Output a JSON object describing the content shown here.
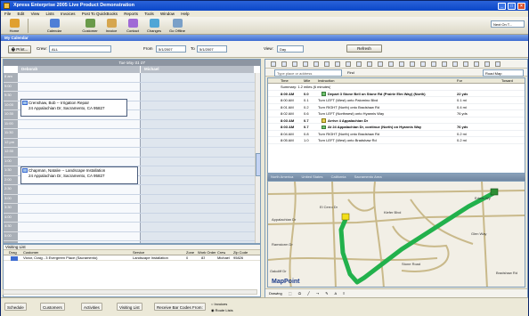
{
  "window": {
    "title": "Xpress Enterprise 2005 Live Product Demonstration",
    "controls": {
      "minimize": "_",
      "maximize": "□",
      "close": "×"
    }
  },
  "menu": [
    "File",
    "Edit",
    "View",
    "Lists",
    "Invoices",
    "Post To QuickBooks",
    "Reports",
    "Tools",
    "Window",
    "Help"
  ],
  "toolbar": {
    "buttons": [
      {
        "label": "Home",
        "color": "#e0a030"
      },
      {
        "label": "Calendar",
        "color": "#4f7fd6"
      },
      {
        "label": "Customer",
        "color": "#6a9a4a"
      },
      {
        "label": "Invoice",
        "color": "#d6a64f"
      },
      {
        "label": "Contact",
        "color": "#a06ad6"
      },
      {
        "label": "Changes",
        "color": "#4fa6d6"
      },
      {
        "label": "Go Offline",
        "color": "#7aa0c8"
      }
    ],
    "find_text": "Next On T..."
  },
  "pane_title": "My Calendar",
  "nav": {
    "print_label": "Print...",
    "crew_label": "Crew:",
    "crew_value": "ALL",
    "from_label": "From",
    "from_value": "5/1/2007",
    "to_label": "To",
    "to_value": "5/1/2007",
    "view_label": "View:",
    "view_value": "Day",
    "refresh_label": "Refresh"
  },
  "calendar": {
    "date_header": "Tue May 01 07",
    "columns": [
      "Deborah",
      "Michael"
    ],
    "times": [
      "8 am",
      "9:00",
      "9:30",
      "10:00",
      "10:30",
      "11:00",
      "11:30",
      "12 pm",
      "12:30",
      "1:00",
      "1:30",
      "2:00",
      "2:30",
      "3:00",
      "3:30",
      "4:00",
      "4:30",
      "5:00"
    ],
    "appointments": [
      {
        "line1": "Crenshaw, Bob -- Irrigation Repair",
        "line2": "24 Appalachian Dr, Sacramento, CA 95827"
      },
      {
        "line1": "Chapman, Natalie -- Landscape Installation",
        "line2": "24 Appalachian Dr, Sacramento, CA 95827"
      }
    ]
  },
  "visiting_list": {
    "title": "Visiting List",
    "headers": [
      "Drag",
      "Customer",
      "Service",
      "Zone",
      "Work Order",
      "Crew",
      "Zip Code"
    ],
    "rows": [
      [
        "",
        "Victor, Craig - 3 Evergreen Place (Sacramento)",
        "Landscape Installation",
        "0",
        "83",
        "Michael",
        "95826"
      ]
    ]
  },
  "bottom_buttons": [
    "Schedule",
    "Customers",
    "Activities",
    "Visiting List",
    "Receive Bar Codes From:"
  ],
  "bottom_radios": [
    "Invoices",
    "Route Lists"
  ],
  "directions": {
    "address_placeholder": "Type place or address",
    "find_label": "Find",
    "map_name": "Road Map",
    "headers": [
      "Time",
      "Mile",
      "Instruction",
      "For",
      "Toward"
    ],
    "summary": "Summary: 1.2 miles (6 minutes)",
    "rows": [
      {
        "time": "8:00 AM",
        "mile": "0.0",
        "text": "Depart 3 Stone Bell on Stone Rd (Prairie Elm Way) (North)",
        "for": "22 yds",
        "bold": true
      },
      {
        "time": "8:00 AM",
        "mile": "0.1",
        "text": "Turn LEFT (West) onto Palomino Blvd",
        "for": "0.1 mi",
        "bold": false
      },
      {
        "time": "8:01 AM",
        "mile": "0.2",
        "text": "Turn RIGHT (North) onto Bradshaw Rd",
        "for": "0.4 mi",
        "bold": false
      },
      {
        "time": "8:02 AM",
        "mile": "0.6",
        "text": "Turn LEFT (Northwest) onto Hyannis Way",
        "for": "76 yds",
        "bold": false
      },
      {
        "time": "8:03 AM",
        "mile": "0.7",
        "text": "Arrive 4 Appalachian Dr",
        "for": "",
        "bold": true
      },
      {
        "time": "8:03 AM",
        "mile": "0.7",
        "text": "At 24 Appalachian Dr, continue (North) on Hyannis Way",
        "for": "76 yds",
        "bold": true
      },
      {
        "time": "8:04 AM",
        "mile": "0.8",
        "text": "Turn RIGHT (North) onto Bradshaw Rd",
        "for": "0.2 mi",
        "bold": false
      },
      {
        "time": "8:05 AM",
        "mile": "1.0",
        "text": "Turn LEFT (West) onto Bradshaw Rd",
        "for": "0.2 mi",
        "bold": false
      }
    ],
    "map_header_items": [
      "North America",
      "United States",
      "California",
      "Sacramento Area"
    ],
    "street_labels": [
      "Appalachian Dr",
      "Ramstorm Dr",
      "Oakcliff Dr",
      "El Cerro Dr",
      "Kiefer Blvd",
      "Stone Road",
      "Glen Way",
      "Bradshaw Rd",
      "Edwin Wy"
    ],
    "logo": "MapPoint",
    "drawing_label": "Drawing"
  },
  "colors": {
    "route": "#22b14c",
    "titlebar": "#0a46c8",
    "calendar_hdr": "#8d95a1"
  }
}
